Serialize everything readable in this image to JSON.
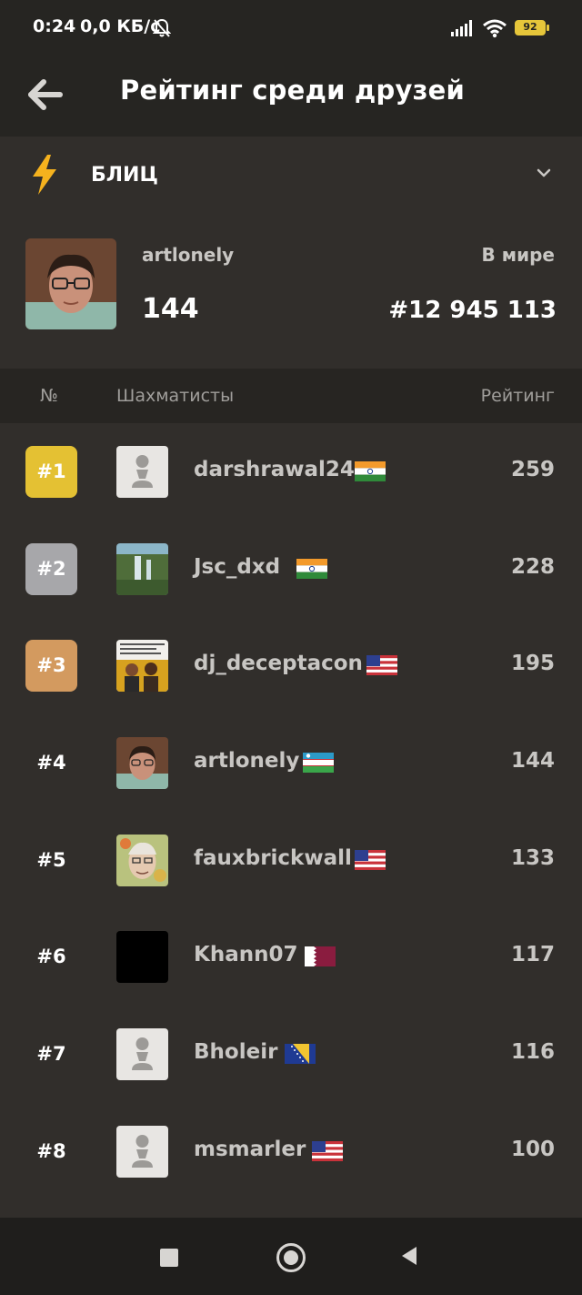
{
  "statusbar": {
    "time": "0:24",
    "network": "0,0 КБ/с",
    "battery": "92"
  },
  "header": {
    "title": "Рейтинг среди друзей"
  },
  "mode": {
    "label": "БЛИЦ",
    "icon": "lightning-icon"
  },
  "me": {
    "username": "artlonely",
    "rating": "144",
    "world_label": "В мире",
    "world_rank": "#12 945 113"
  },
  "table": {
    "col_num": "№",
    "col_players": "Шахматисты",
    "col_rating": "Рейтинг"
  },
  "colors": {
    "gold": "#e4c133",
    "silver": "#a7a7aa",
    "bronze": "#d39a5f",
    "background": "#312e2b",
    "header_bg": "#262522"
  },
  "rows": [
    {
      "rank": "#1",
      "username": "darshrawal24",
      "flag": "india",
      "rating": "259",
      "avatar": "pawn-placeholder",
      "medal": "gold"
    },
    {
      "rank": "#2",
      "username": "Jsc_dxd",
      "flag": "india",
      "rating": "228",
      "avatar": "waterfall-photo",
      "medal": "silver"
    },
    {
      "rank": "#3",
      "username": "dj_deceptacon",
      "flag": "usa",
      "rating": "195",
      "avatar": "group-photo",
      "medal": "bronze"
    },
    {
      "rank": "#4",
      "username": "artlonely",
      "flag": "uzbekistan",
      "rating": "144",
      "avatar": "user-photo",
      "medal": ""
    },
    {
      "rank": "#5",
      "username": "fauxbrickwall",
      "flag": "usa",
      "rating": "133",
      "avatar": "portrait-photo",
      "medal": ""
    },
    {
      "rank": "#6",
      "username": "Khann07",
      "flag": "qatar",
      "rating": "117",
      "avatar": "black-square",
      "medal": ""
    },
    {
      "rank": "#7",
      "username": "Bholeir",
      "flag": "bosnia",
      "rating": "116",
      "avatar": "pawn-placeholder",
      "medal": ""
    },
    {
      "rank": "#8",
      "username": "msmarler",
      "flag": "usa",
      "rating": "100",
      "avatar": "pawn-placeholder",
      "medal": ""
    }
  ]
}
